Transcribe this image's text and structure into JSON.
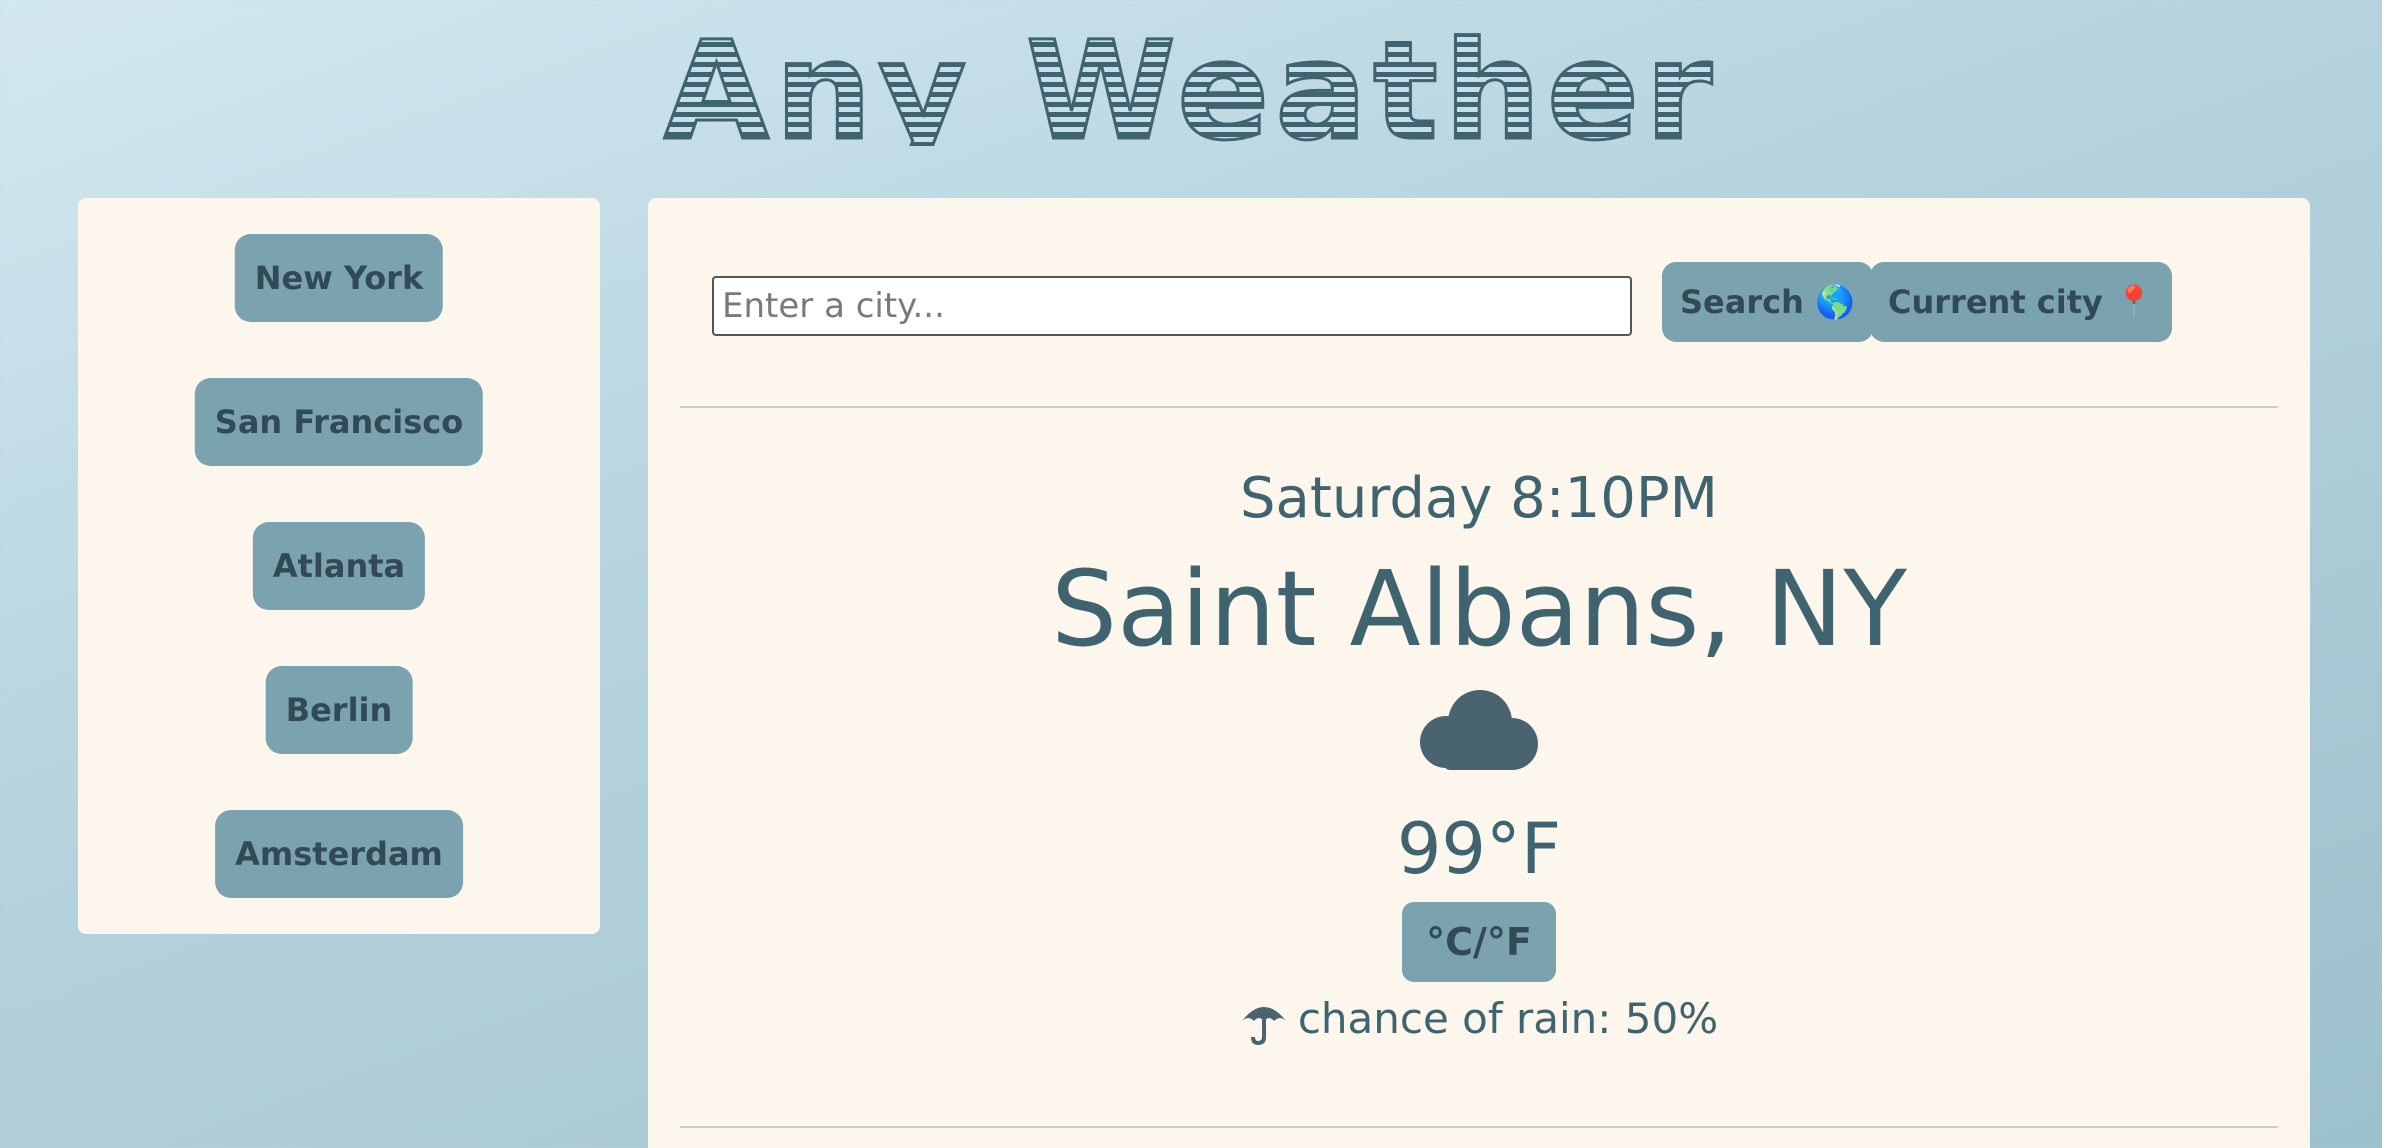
{
  "header": {
    "title": "Any Weather"
  },
  "sidebar": {
    "cities": [
      {
        "label": "New York"
      },
      {
        "label": "San Francisco"
      },
      {
        "label": "Atlanta"
      },
      {
        "label": "Berlin"
      },
      {
        "label": "Amsterdam"
      }
    ]
  },
  "search": {
    "placeholder": "Enter a city...",
    "value": "",
    "search_label": "Search 🌎",
    "current_city_label": "Current city 📍"
  },
  "weather": {
    "day_time": "Saturday 8:10PM",
    "city": "Saint Albans, NY",
    "condition_icon": "cloud-icon",
    "temperature": "99°F",
    "unit_toggle_label": "°C/°F",
    "rain_icon": "umbrella-icon",
    "rain_text": "chance of rain: 50%"
  },
  "colors": {
    "accent": "#7aa2af",
    "text": "#3f6470",
    "panel": "#fcf6ec"
  }
}
